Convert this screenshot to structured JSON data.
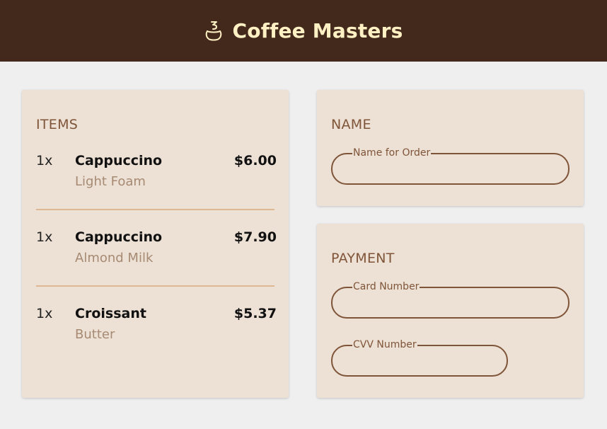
{
  "header": {
    "brand": "Coffee Masters",
    "logo_icon": "coffee-cup-icon",
    "background": "#43281c",
    "brand_color": "#fff1c4"
  },
  "items_section": {
    "title": "ITEMS",
    "items": [
      {
        "qty": "1x",
        "name": "Cappuccino",
        "option": "Light Foam",
        "price": "$6.00"
      },
      {
        "qty": "1x",
        "name": "Cappuccino",
        "option": "Almond Milk",
        "price": "$7.90"
      },
      {
        "qty": "1x",
        "name": "Croissant",
        "option": "Butter",
        "price": "$5.37"
      }
    ]
  },
  "name_section": {
    "title": "NAME",
    "name_field": {
      "label": "Name for Order",
      "value": ""
    }
  },
  "payment_section": {
    "title": "PAYMENT",
    "card_field": {
      "label": "Card Number",
      "value": ""
    },
    "cvv_field": {
      "label": "CVV Number",
      "value": ""
    }
  },
  "colors": {
    "card_background": "#ede0d4",
    "accent": "#7f5539",
    "divider": "#ddb892",
    "muted_text": "#a68a73",
    "page_background": "#efefef"
  }
}
